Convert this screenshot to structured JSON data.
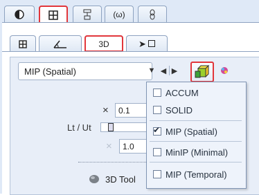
{
  "tabs_top": [
    {
      "icon": "contrast-icon",
      "selected": false,
      "highlighted": false
    },
    {
      "icon": "grid-icon",
      "selected": true,
      "highlighted": true
    },
    {
      "icon": "tools-icon",
      "selected": false,
      "highlighted": false
    },
    {
      "icon": "signal-icon",
      "selected": false,
      "highlighted": false
    },
    {
      "icon": "chain-icon",
      "selected": false,
      "highlighted": false
    }
  ],
  "tabs_sub": [
    {
      "icon": "grid-icon",
      "label": "",
      "selected": false
    },
    {
      "icon": "angle-icon",
      "label": "",
      "selected": false
    },
    {
      "icon": "",
      "label": "3D",
      "selected": true
    },
    {
      "icon": "pointer-box-icon",
      "label": "",
      "selected": false
    }
  ],
  "render_mode": {
    "selected": "MIP (Spatial)",
    "controls": [
      "▼",
      "◀",
      "▶"
    ]
  },
  "dropdown": {
    "items": [
      {
        "label": "ACCUM",
        "checked": false
      },
      {
        "label": "SOLID",
        "checked": false
      },
      {
        "label": "MIP (Spatial)",
        "checked": true
      },
      {
        "label": "MinIP (Minimal)",
        "checked": false
      },
      {
        "label": "MIP (Temporal)",
        "checked": false
      }
    ]
  },
  "params": {
    "multiply_symbol": "×",
    "multiply_value": "0.1",
    "ltut_label": "Lt / Ut",
    "second_value": "1.0"
  },
  "tool": {
    "label": "3D Tool"
  },
  "colors": {
    "highlight": "#e2363b",
    "panel": "#dfe9f7",
    "menu": "#eef3fb"
  }
}
